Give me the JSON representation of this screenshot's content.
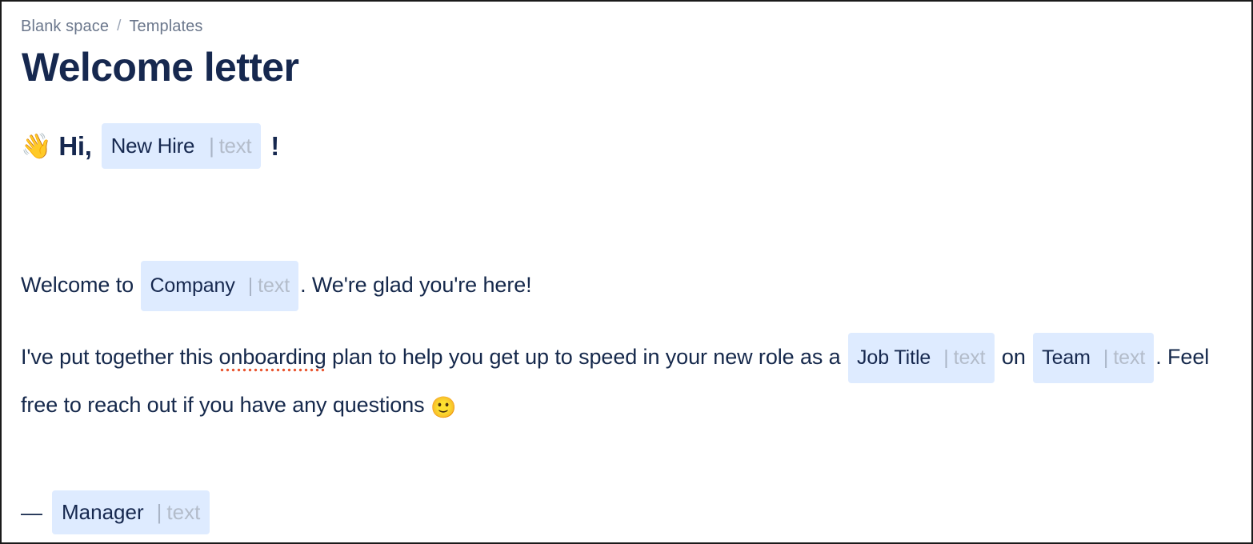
{
  "breadcrumb": {
    "items": [
      {
        "label": "Blank space"
      },
      {
        "label": "Templates"
      }
    ],
    "separator": "/"
  },
  "document": {
    "title": "Welcome letter"
  },
  "content": {
    "greeting": {
      "wave_emoji": "👋",
      "salutation": "Hi,",
      "chip": {
        "name": "New Hire",
        "divider": "|",
        "type": "text"
      },
      "punctuation": "!"
    },
    "paragraph1": {
      "before": "Welcome to",
      "chip": {
        "name": "Company",
        "divider": "|",
        "type": "text"
      },
      "after": ". We're glad you're here!"
    },
    "paragraph2": {
      "part1": "I've put together this",
      "misspelled_word": "onboarding",
      "part2": "plan to help you get up to speed in your new role as a",
      "chip_job": {
        "name": "Job Title",
        "divider": "|",
        "type": "text"
      },
      "part3": "on",
      "chip_team": {
        "name": "Team",
        "divider": "|",
        "type": "text"
      },
      "part4": ". Feel free to reach out if you have any questions",
      "smile_emoji": "🙂"
    },
    "signature": {
      "dash": "—",
      "chip": {
        "name": "Manager",
        "divider": "|",
        "type": "text"
      }
    }
  },
  "colors": {
    "chip_background": "#deebff",
    "chip_text": "#16284f",
    "chip_type_text": "#b3bcca",
    "heading": "#16284f",
    "body_text": "#15284b",
    "breadcrumb": "#6b778c",
    "spellcheck_underline": "#e8552f",
    "page_background": "#ffffff"
  }
}
